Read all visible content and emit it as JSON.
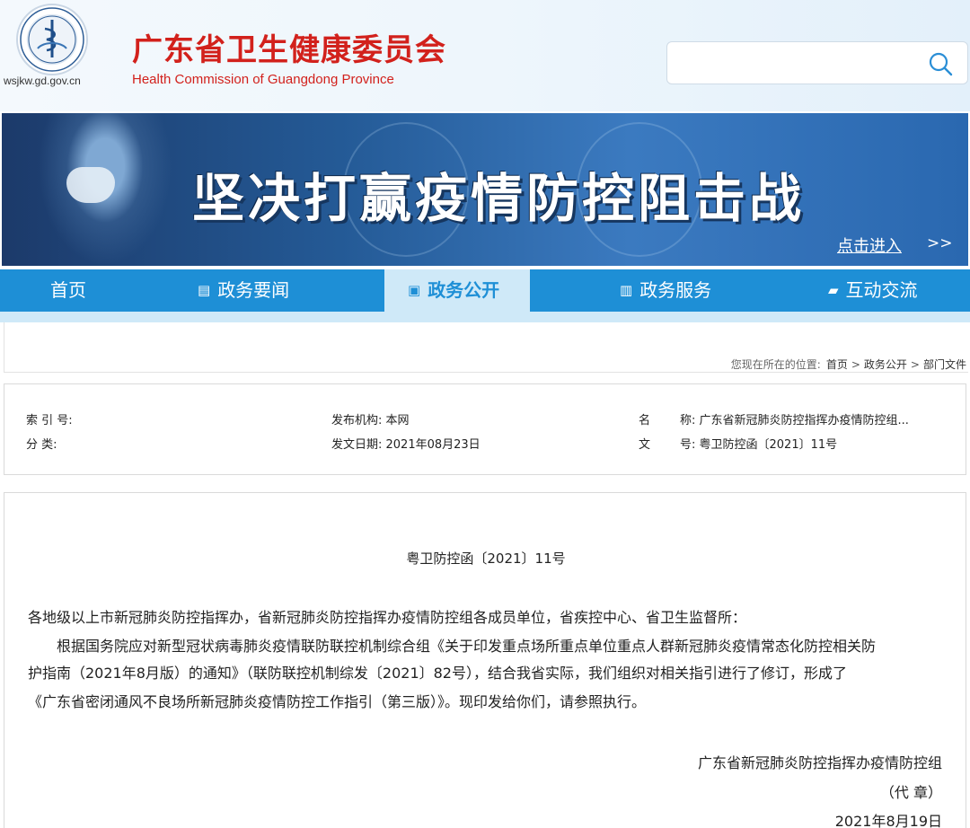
{
  "header": {
    "domain": "wsjkw.gd.gov.cn",
    "org_cn": "广东省卫生健康委员会",
    "org_en": "Health Commission of Guangdong Province",
    "search_placeholder": "",
    "search_icon": "search-icon",
    "emblem_icon": "health-emblem-logo"
  },
  "banner": {
    "title": "坚决打赢疫情防控阻击战",
    "link": "点击进入",
    "arrow": ">>"
  },
  "nav": {
    "items": [
      {
        "label": "首页",
        "icon": ""
      },
      {
        "label": "政务要闻",
        "icon": "news-icon"
      },
      {
        "label": "政务公开",
        "icon": "open-doc-icon",
        "active": true
      },
      {
        "label": "政务服务",
        "icon": "service-icon"
      },
      {
        "label": "互动交流",
        "icon": "chat-icon"
      }
    ]
  },
  "breadcrumb": {
    "prefix": "您现在所在的位置:",
    "items": [
      "首页",
      "政务公开",
      "部门文件"
    ],
    "sep": ">"
  },
  "meta": {
    "index_label": "索 引 号:",
    "category_label": "分 类:",
    "publisher": "发布机构: 本网",
    "date": "发文日期: 2021年08月23日",
    "name_label": "名",
    "name_value": "称: 广东省新冠肺炎防控指挥办疫情防控组...",
    "doc_label": "文",
    "doc_value": "号: 粤卫防控函〔2021〕11号"
  },
  "document": {
    "doc_number": "粤卫防控函〔2021〕11号",
    "addressee": "各地级以上市新冠肺炎防控指挥办，省新冠肺炎防控指挥办疫情防控组各成员单位，省疾控中心、省卫生监督所：",
    "body_line1": "根据国务院应对新型冠状病毒肺炎疫情联防联控机制综合组《关于印发重点场所重点单位重点人群新冠肺炎疫情常态化防控相关防",
    "body_line2": "护指南（2021年8月版）的通知》（联防联控机制综发〔2021〕82号），结合我省实际，我们组织对相关指引进行了修订，形成了",
    "body_line3": "《广东省密闭通风不良场所新冠肺炎疫情防控工作指引（第三版）》。现印发给你们，请参照执行。",
    "signer": "广东省新冠肺炎防控指挥办疫情防控组",
    "seal": "（代 章）",
    "sign_date": "2021年8月19日"
  },
  "colors": {
    "brand_red": "#d2211c",
    "nav_blue": "#1e8fd6",
    "nav_active_bg": "#cfe9f8"
  }
}
